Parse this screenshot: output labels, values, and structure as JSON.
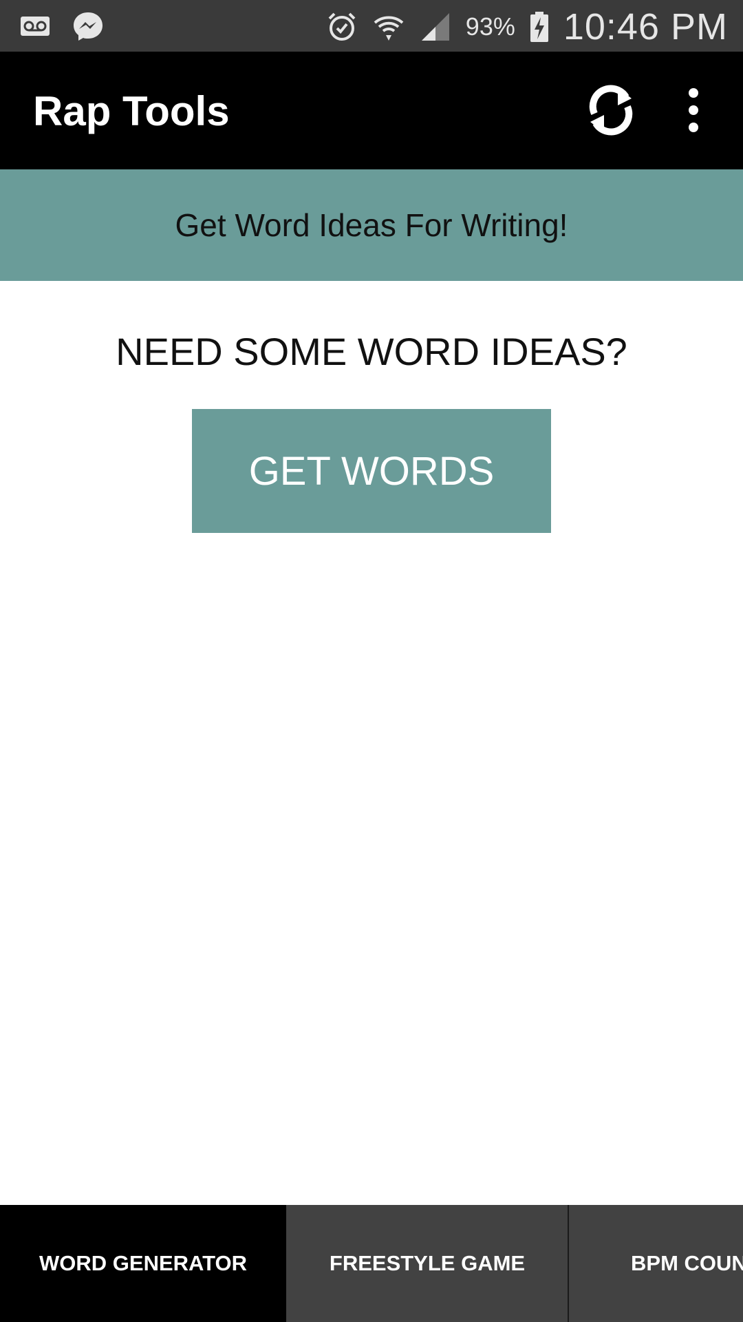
{
  "status_bar": {
    "icons_left": [
      "voicemail-icon",
      "messenger-icon"
    ],
    "icons_right": [
      "alarm-icon",
      "wifi-icon",
      "cell-signal-icon",
      "battery-charging-icon"
    ],
    "battery_percent": "93%",
    "time": "10:46 PM"
  },
  "app_bar": {
    "title": "Rap Tools",
    "actions": [
      "refresh-icon",
      "more-vert-icon"
    ]
  },
  "banner": {
    "text": "Get Word Ideas For Writing!"
  },
  "main": {
    "prompt": "NEED SOME WORD IDEAS?",
    "button_label": "GET WORDS"
  },
  "tabs": [
    {
      "label": "WORD GENERATOR",
      "active": true
    },
    {
      "label": "FREESTYLE GAME",
      "active": false
    },
    {
      "label": "BPM COUNTER",
      "active": false
    }
  ],
  "colors": {
    "accent": "#6a9c99",
    "app_bar": "#000000",
    "status_bar": "#3a3a3a",
    "tab_bar": "#424242"
  }
}
